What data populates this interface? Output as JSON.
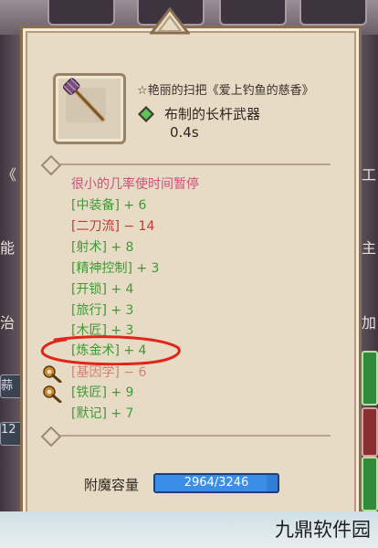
{
  "background": {
    "left_labels": [
      "《",
      "能",
      "治",
      "蒜",
      "12"
    ],
    "right_labels": [
      "工",
      "主",
      "加"
    ]
  },
  "item": {
    "title": "☆艳丽的扫把《爱上钓鱼的慈香》",
    "type": "布制的长杆武器",
    "time": "0.4s",
    "icon": "broom-staff-icon",
    "type_icon": "green-diamond-icon"
  },
  "effects": [
    {
      "text": "很小的几率使时间暂停",
      "color": "pink"
    },
    {
      "text": "[中装备] + 6",
      "color": "green"
    },
    {
      "text": "[二刀流] − 14",
      "color": "red"
    },
    {
      "text": "[射术] + 8",
      "color": "green"
    },
    {
      "text": "[精神控制] + 3",
      "color": "green"
    },
    {
      "text": "[开锁] + 4",
      "color": "green"
    },
    {
      "text": "[旅行] + 3",
      "color": "green"
    },
    {
      "text": "[木匠] + 3",
      "color": "green"
    },
    {
      "text": "[炼金术] + 4",
      "color": "green"
    },
    {
      "text": "[基因学] − 6",
      "color": "red"
    },
    {
      "text": "[铁匠] + 9",
      "color": "green"
    },
    {
      "text": "[默记] + 7",
      "color": "green"
    }
  ],
  "capacity": {
    "label": "附魔容量",
    "value": "2964/3246",
    "current": 2964,
    "max": 3246
  },
  "watermark": "九鼎软件园",
  "colors": {
    "pink": "#d04e7a",
    "green": "#3d9b34",
    "red": "#c03a33",
    "panel": "#e7dbc6",
    "bar": "#2f7fd6",
    "annotation": "#e0261c"
  }
}
